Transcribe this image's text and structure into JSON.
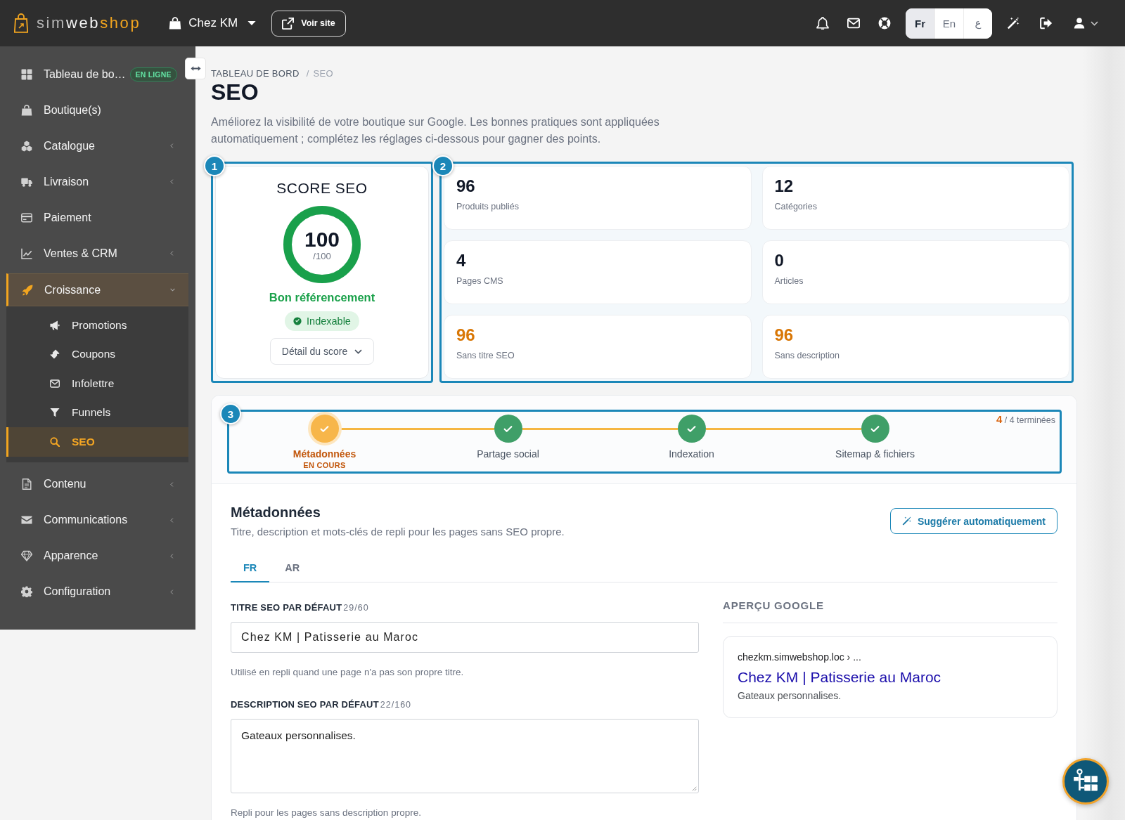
{
  "topbar": {
    "logo": [
      "sim",
      "web",
      "shop"
    ],
    "store": "Chez KM",
    "view_site_button": "Voir site",
    "languages": [
      {
        "label": "Fr",
        "selected": true
      },
      {
        "label": "En",
        "selected": false
      },
      {
        "label": "ع",
        "selected": false
      }
    ]
  },
  "sidebar": {
    "items": [
      {
        "label": "Tableau de bo…",
        "kind": "link",
        "selected": false,
        "badge": "EN LIGNE"
      },
      {
        "label": "Boutique(s)",
        "kind": "link",
        "selected": false
      },
      {
        "label": "Catalogue",
        "kind": "group",
        "selected": false,
        "expanded": false
      },
      {
        "label": "Livraison",
        "kind": "group",
        "selected": false,
        "expanded": false
      },
      {
        "label": "Paiement",
        "kind": "link",
        "selected": false
      },
      {
        "label": "Ventes & CRM",
        "kind": "group",
        "selected": false,
        "expanded": false
      },
      {
        "label": "Croissance",
        "kind": "group",
        "selected": true,
        "expanded": true,
        "children": [
          {
            "label": "Promotions",
            "selected": false
          },
          {
            "label": "Coupons",
            "selected": false
          },
          {
            "label": "Infolettre",
            "selected": false
          },
          {
            "label": "Funnels",
            "selected": false
          },
          {
            "label": "SEO",
            "selected": true
          }
        ]
      },
      {
        "label": "Contenu",
        "kind": "group",
        "selected": false,
        "expanded": false
      },
      {
        "label": "Communications",
        "kind": "group",
        "selected": false,
        "expanded": false
      },
      {
        "label": "Apparence",
        "kind": "group",
        "selected": false,
        "expanded": false
      },
      {
        "label": "Configuration",
        "kind": "group",
        "selected": false,
        "expanded": false
      }
    ]
  },
  "breadcrumb": {
    "items": [
      "TABLEAU DE BORD",
      "SEO"
    ],
    "separator": "/"
  },
  "page_title": "SEO",
  "intro": "Améliorez la visibilité de votre boutique sur Google. Les bonnes pratiques sont appliquées automatiquement ; complétez les réglages ci-dessous pour gagner des points.",
  "score_card": {
    "tour_step": "1",
    "title": "SCORE SEO",
    "score": "100",
    "max": "/100",
    "level": 1,
    "rating": "Bon référencement",
    "status": "Indexable",
    "detail_button": "Détail du score"
  },
  "stats": {
    "tour_step": "2",
    "items": [
      {
        "value": "96",
        "label": "Produits publiés",
        "warning": false
      },
      {
        "value": "12",
        "label": "Catégories",
        "warning": false
      },
      {
        "value": "4",
        "label": "Pages CMS",
        "warning": false
      },
      {
        "value": "0",
        "label": "Articles",
        "warning": false
      },
      {
        "value": "96",
        "label": "Sans titre SEO",
        "warning": true
      },
      {
        "value": "96",
        "label": "Sans description",
        "warning": true
      }
    ]
  },
  "progress": {
    "tour_step": "3",
    "steps": [
      {
        "label": "Métadonnées",
        "selected": true,
        "done": true,
        "note": "EN COURS"
      },
      {
        "label": "Partage social",
        "selected": false,
        "done": true
      },
      {
        "label": "Indexation",
        "selected": false,
        "done": true
      },
      {
        "label": "Sitemap & fichiers",
        "selected": false,
        "done": true
      }
    ],
    "summary": "**4** / 4 terminées"
  },
  "metadata": {
    "title": "Métadonnées",
    "subtitle": "Titre, description et mots-clés de repli pour les pages sans SEO propre.",
    "suggest_button": "Suggérer automatiquement",
    "tabs": [
      {
        "label": "FR",
        "selected": true
      },
      {
        "label": "AR",
        "selected": false
      }
    ],
    "fields": [
      {
        "kind": "input",
        "label": "TITRE SEO PAR DÉFAUT",
        "counter": "29/60",
        "value": "Chez KM | Patisserie au Maroc",
        "hint": "Utilisé en repli quand une page n'a pas son propre titre."
      },
      {
        "kind": "textarea",
        "label": "DESCRIPTION SEO PAR DÉFAUT",
        "counter": "22/160",
        "value": "Gateaux personnalises.",
        "hint": "Repli pour les pages sans description propre."
      }
    ],
    "google_preview": {
      "heading": "APERÇU GOOGLE",
      "url": "chezkm.simwebshop.loc › ...",
      "link": "Chez KM | Patisserie au Maroc",
      "snippet": "Gateaux personnalises."
    }
  }
}
